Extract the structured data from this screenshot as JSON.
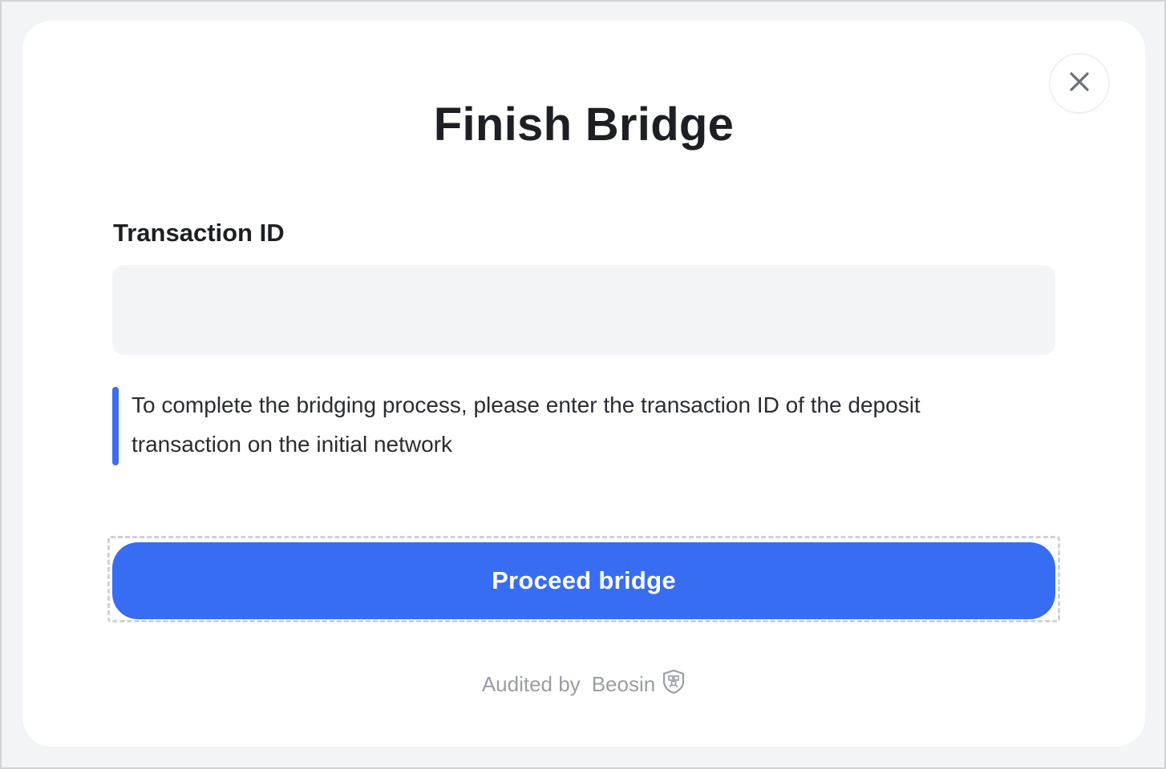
{
  "modal": {
    "title": "Finish Bridge",
    "close_icon": "close-icon"
  },
  "form": {
    "label": "Transaction ID",
    "input_value": "",
    "input_placeholder": ""
  },
  "notice": {
    "text": "To complete the bridging process, please enter the transaction ID of the deposit transaction on the initial network",
    "accent_color": "#3a6df0"
  },
  "actions": {
    "proceed_label": "Proceed bridge",
    "button_color": "#376df2"
  },
  "footer": {
    "audited_by": "Audited by",
    "auditor": "Beosin",
    "auditor_icon": "beosin-shield-icon"
  }
}
